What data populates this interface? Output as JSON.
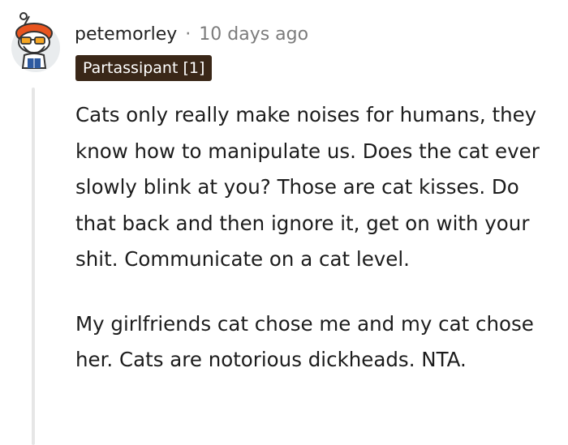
{
  "comment": {
    "author": "petemorley",
    "separator": "·",
    "timestamp": "10 days ago",
    "flair": "Partassipant [1]",
    "avatar_icon": "snoo-avatar-icon",
    "paragraphs": [
      "Cats only really make noises for humans, they know how to manipulate us. Does the cat ever slowly blink at you? Those are cat kisses. Do that back and then ignore it, get on with your shit. Communicate on a cat level.",
      "My girlfriends cat chose me and my cat chose her. Cats are notorious dickheads. NTA."
    ]
  },
  "colors": {
    "flair_background": "#3a2718",
    "muted_text": "#7c7c7c",
    "thread_line": "#e6e6e6"
  }
}
